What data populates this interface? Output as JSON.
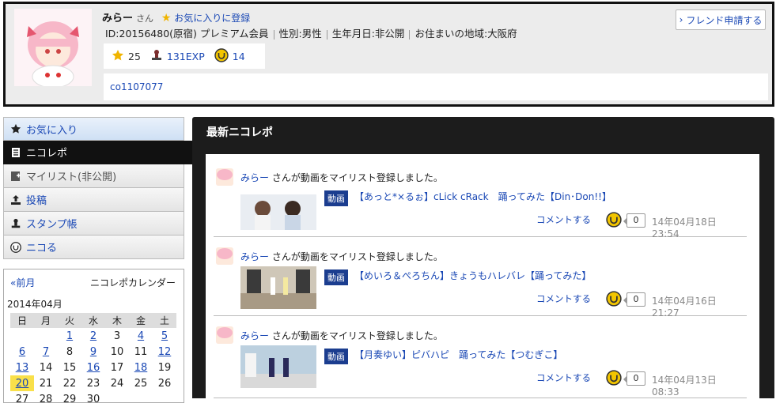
{
  "profile": {
    "name": "みらー",
    "honorific": "さん",
    "fav_register": "お気に入りに登録",
    "id_text": "ID:20156480(原宿) プレミアム会員",
    "gender": "性別:男性",
    "birthday": "生年月日:非公開",
    "region": "お住まいの地域:大阪府",
    "stars": "25",
    "exp": "131EXP",
    "nicoru": "14",
    "community": "co1107077",
    "friend_button": "フレンド申請する"
  },
  "sidebar": {
    "items": [
      {
        "label": "お気に入り",
        "icon": "star-icon"
      },
      {
        "label": "ニコレポ",
        "icon": "document-icon"
      },
      {
        "label": "マイリスト(非公開)",
        "icon": "mylist-icon"
      },
      {
        "label": "投稿",
        "icon": "upload-icon"
      },
      {
        "label": "スタンプ帳",
        "icon": "stamp-icon"
      },
      {
        "label": "ニコる",
        "icon": "nicoru-icon"
      }
    ]
  },
  "calendar": {
    "prev": "«前月",
    "title": "ニコレポカレンダー",
    "month": "2014年04月",
    "weekdays": [
      "日",
      "月",
      "火",
      "水",
      "木",
      "金",
      "土"
    ],
    "rows": [
      [
        "",
        "",
        "1",
        "2",
        "3",
        "4",
        "5"
      ],
      [
        "6",
        "7",
        "8",
        "9",
        "10",
        "11",
        "12"
      ],
      [
        "13",
        "14",
        "15",
        "16",
        "17",
        "18",
        "19"
      ],
      [
        "20",
        "21",
        "22",
        "23",
        "24",
        "25",
        "26"
      ],
      [
        "27",
        "28",
        "29",
        "30",
        "",
        "",
        ""
      ]
    ]
  },
  "main": {
    "title": "最新ニコレポ",
    "reports": [
      {
        "user": "みらー",
        "action": " さんが動画をマイリスト登録しました。",
        "badge": "動画",
        "title": "【あっと*×るぉ】cLick cRack　踊ってみた【Din･Don!!】",
        "comment": "コメントする",
        "count": "0",
        "date": "14年04月18日 23:54"
      },
      {
        "user": "みらー",
        "action": " さんが動画をマイリスト登録しました。",
        "badge": "動画",
        "title": "【めいろ＆ぺろちん】きょうもハレバレ【踊ってみた】",
        "comment": "コメントする",
        "count": "0",
        "date": "14年04月16日 21:27"
      },
      {
        "user": "みらー",
        "action": " さんが動画をマイリスト登録しました。",
        "badge": "動画",
        "title": "【月奏ゆい】ピバハピ　踊ってみた【つむぎこ】",
        "comment": "コメントする",
        "count": "0",
        "date": "14年04月13日 08:33"
      }
    ]
  },
  "colors": {
    "accent": "#1a48b5",
    "header_dark": "#1c1c1c",
    "badge": "#1b3d8f",
    "today": "#f9e04a",
    "nicoru": "#f2c500"
  }
}
